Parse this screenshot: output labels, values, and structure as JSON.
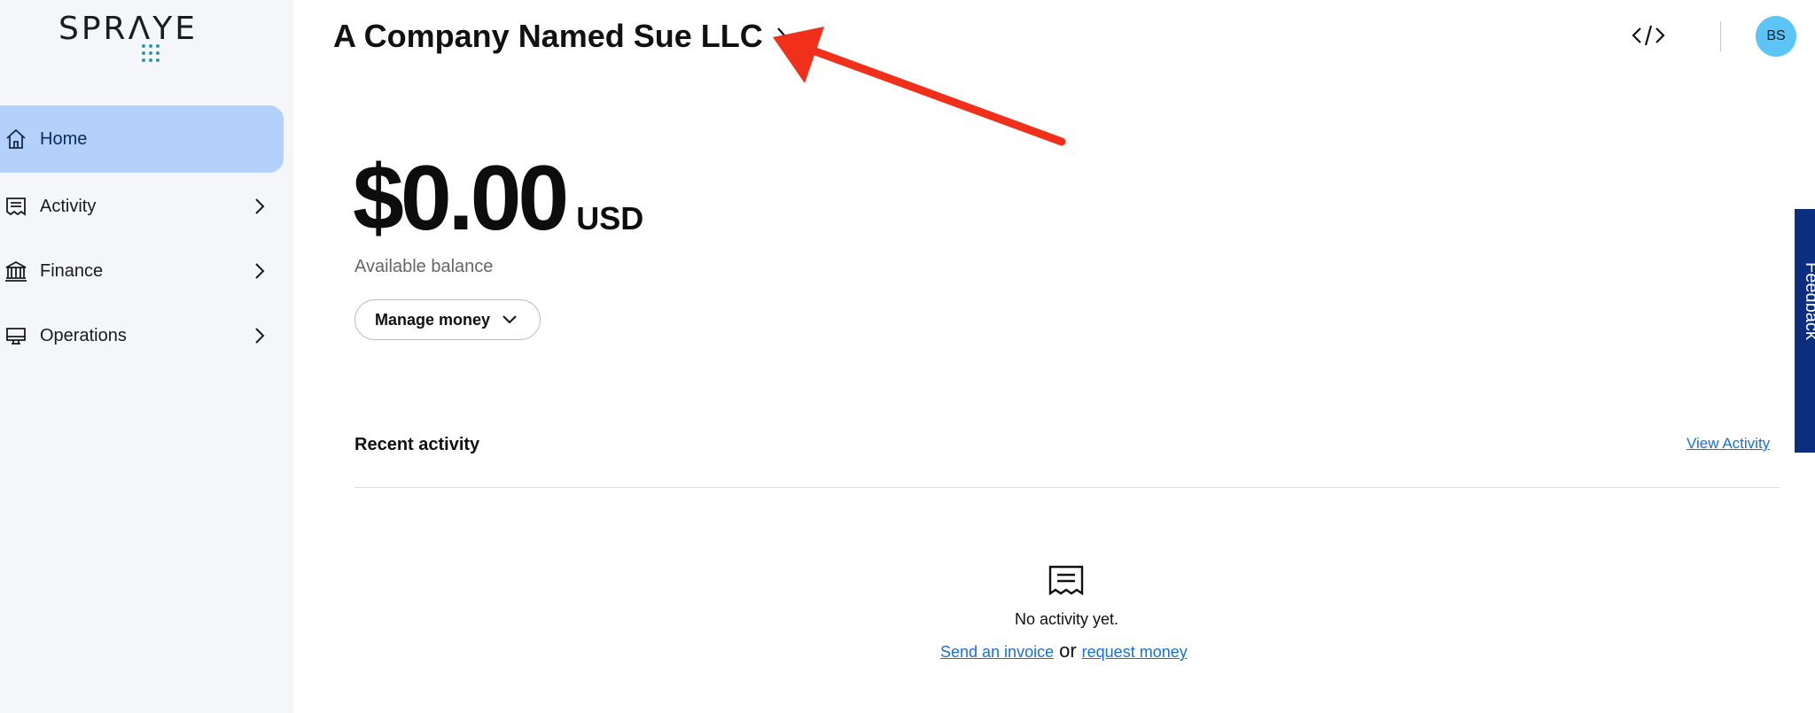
{
  "brand": {
    "logo_text": "SPRΛYE"
  },
  "sidebar": {
    "items": [
      {
        "label": "Home",
        "icon": "home-icon",
        "active": true
      },
      {
        "label": "Activity",
        "icon": "receipt-icon",
        "active": false
      },
      {
        "label": "Finance",
        "icon": "bank-icon",
        "active": false
      },
      {
        "label": "Operations",
        "icon": "monitor-icon",
        "active": false
      }
    ]
  },
  "header": {
    "company_name": "A Company Named Sue LLC",
    "avatar_initials": "BS"
  },
  "balance": {
    "amount": "$0.00",
    "currency": "USD",
    "label": "Available balance",
    "manage_label": "Manage money"
  },
  "recent": {
    "title": "Recent activity",
    "view_link": "View Activity",
    "empty_text": "No activity yet.",
    "send_invoice": "Send an invoice",
    "or_text": "or",
    "request_money": "request money"
  },
  "feedback": {
    "label": "Feedback"
  },
  "colors": {
    "sidebar_bg": "#f5f6fa",
    "active_nav": "#b3d1fb",
    "link": "#1a6fd8",
    "avatar": "#5cc5f5",
    "feedback_tab": "#0b2e7e",
    "annotation_arrow": "#f0301b"
  }
}
